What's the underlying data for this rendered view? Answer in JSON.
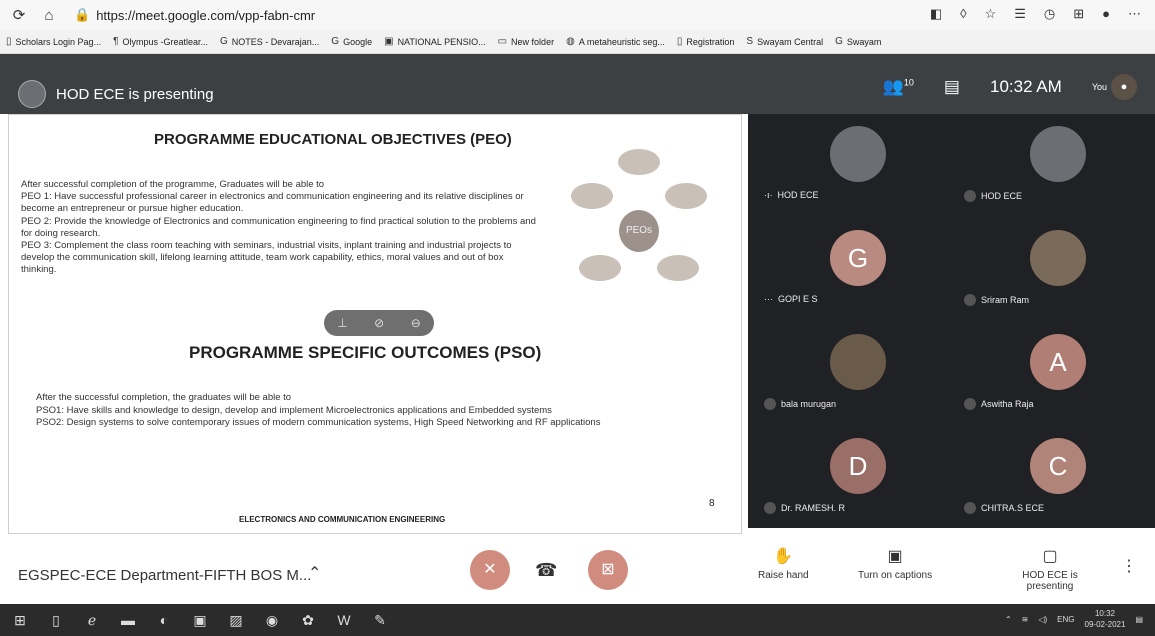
{
  "browser": {
    "url": "https://meet.google.com/vpp-fabn-cmr",
    "bookmarks": [
      "Scholars Login Pag...",
      "Olympus -Greatlear...",
      "NOTES - Devarajan...",
      "Google",
      "NATIONAL PENSIO...",
      "New folder",
      "A metaheuristic seg...",
      "Registration",
      "Swayam Central",
      "Swayam"
    ]
  },
  "meet": {
    "presenter_label": "HOD ECE is presenting",
    "time": "10:32 AM",
    "participant_count": "10",
    "you_label": "You"
  },
  "slide": {
    "peo_title": "PROGRAMME EDUCATIONAL OBJECTIVES (PEO)",
    "peo_intro": "After successful completion of the programme, Graduates will be able to",
    "peo1": "PEO 1: Have successful professional career in electronics and communication engineering and its relative disciplines or become an entrepreneur or pursue higher education.",
    "peo2": "PEO 2: Provide the knowledge of Electronics and communication engineering to find practical solution to the problems and for doing research.",
    "peo3": "PEO 3: Complement the class room teaching with seminars, industrial visits, inplant training and industrial projects to develop the communication skill, lifelong learning attitude, team work capability, ethics, moral values and out of box thinking.",
    "cycle_center": "PEOs",
    "pso_title": "PROGRAMME SPECIFIC OUTCOMES (PSO)",
    "pso_intro": "After the successful completion, the graduates will be able to",
    "pso1": "PSO1: Have skills and knowledge to design, develop and implement Microelectronics applications and Embedded systems",
    "pso2": "PSO2: Design systems to solve contemporary issues of modern communication systems, High Speed Networking and RF applications",
    "footer": "ELECTRONICS AND COMMUNICATION ENGINEERING",
    "page_mark": "8"
  },
  "participants": [
    {
      "name": "HOD ECE",
      "initial": "",
      "color": "#6b6f73"
    },
    {
      "name": "HOD ECE",
      "initial": "",
      "color": "#6b6f73"
    },
    {
      "name": "GOPI E S",
      "initial": "G",
      "color": "#b88a80"
    },
    {
      "name": "Sriram Ram",
      "initial": "",
      "color": "#7a6a5a"
    },
    {
      "name": "bala murugan",
      "initial": "",
      "color": "#6a5a4a"
    },
    {
      "name": "Aswitha Raja",
      "initial": "A",
      "color": "#b07e74"
    },
    {
      "name": "Dr. RAMESH. R",
      "initial": "D",
      "color": "#9a6f68"
    },
    {
      "name": "CHITRA.S ECE",
      "initial": "C",
      "color": "#b08478"
    }
  ],
  "bottom": {
    "meeting_title": "EGSPEC-ECE Department-FIFTH BOS M...",
    "raise_hand": "Raise hand",
    "captions": "Turn on captions",
    "presenting": "HOD ECE is presenting"
  },
  "taskbar": {
    "lang": "ENG",
    "time": "10:32",
    "date": "09-02-2021"
  }
}
